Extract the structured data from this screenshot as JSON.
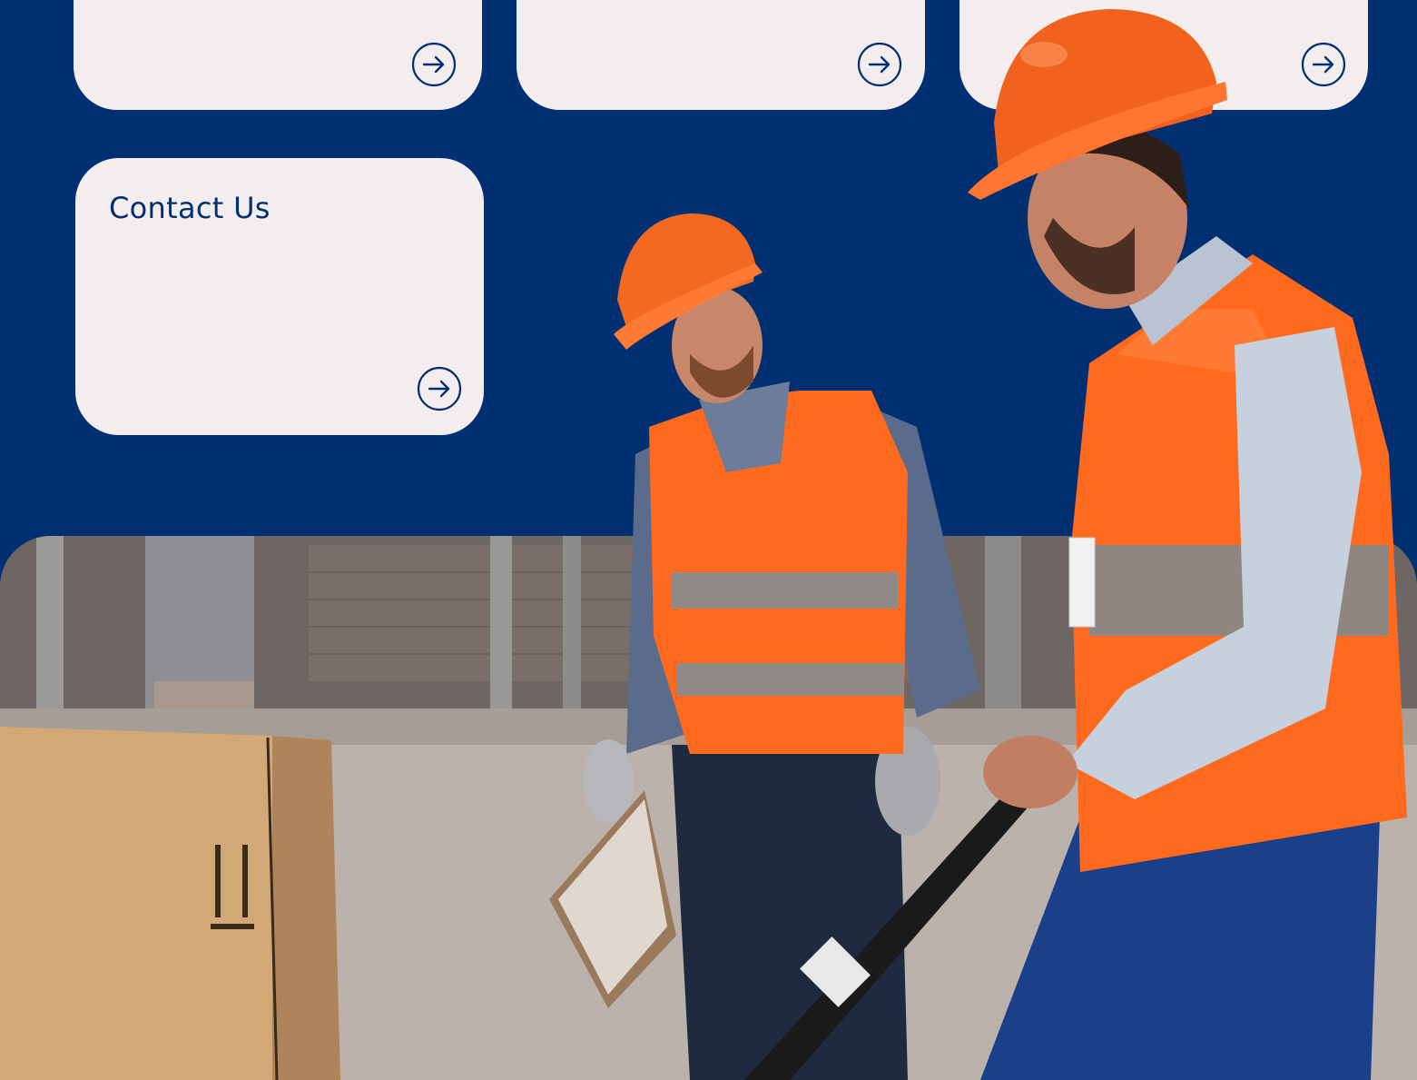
{
  "page": {
    "background_color": "#003072",
    "card_color": "#f4eded",
    "accent_color": "#003072"
  },
  "cards": [
    {
      "id": "card-1",
      "title": "",
      "icon": "arrow-right-circle-icon"
    },
    {
      "id": "card-2",
      "title": "",
      "icon": "arrow-right-circle-icon"
    },
    {
      "id": "card-3",
      "title": "",
      "icon": "arrow-right-circle-icon"
    },
    {
      "id": "contact",
      "title": "Contact Us",
      "icon": "arrow-right-circle-icon"
    }
  ],
  "hero_image": {
    "subject": "warehouse-workers-photo"
  }
}
